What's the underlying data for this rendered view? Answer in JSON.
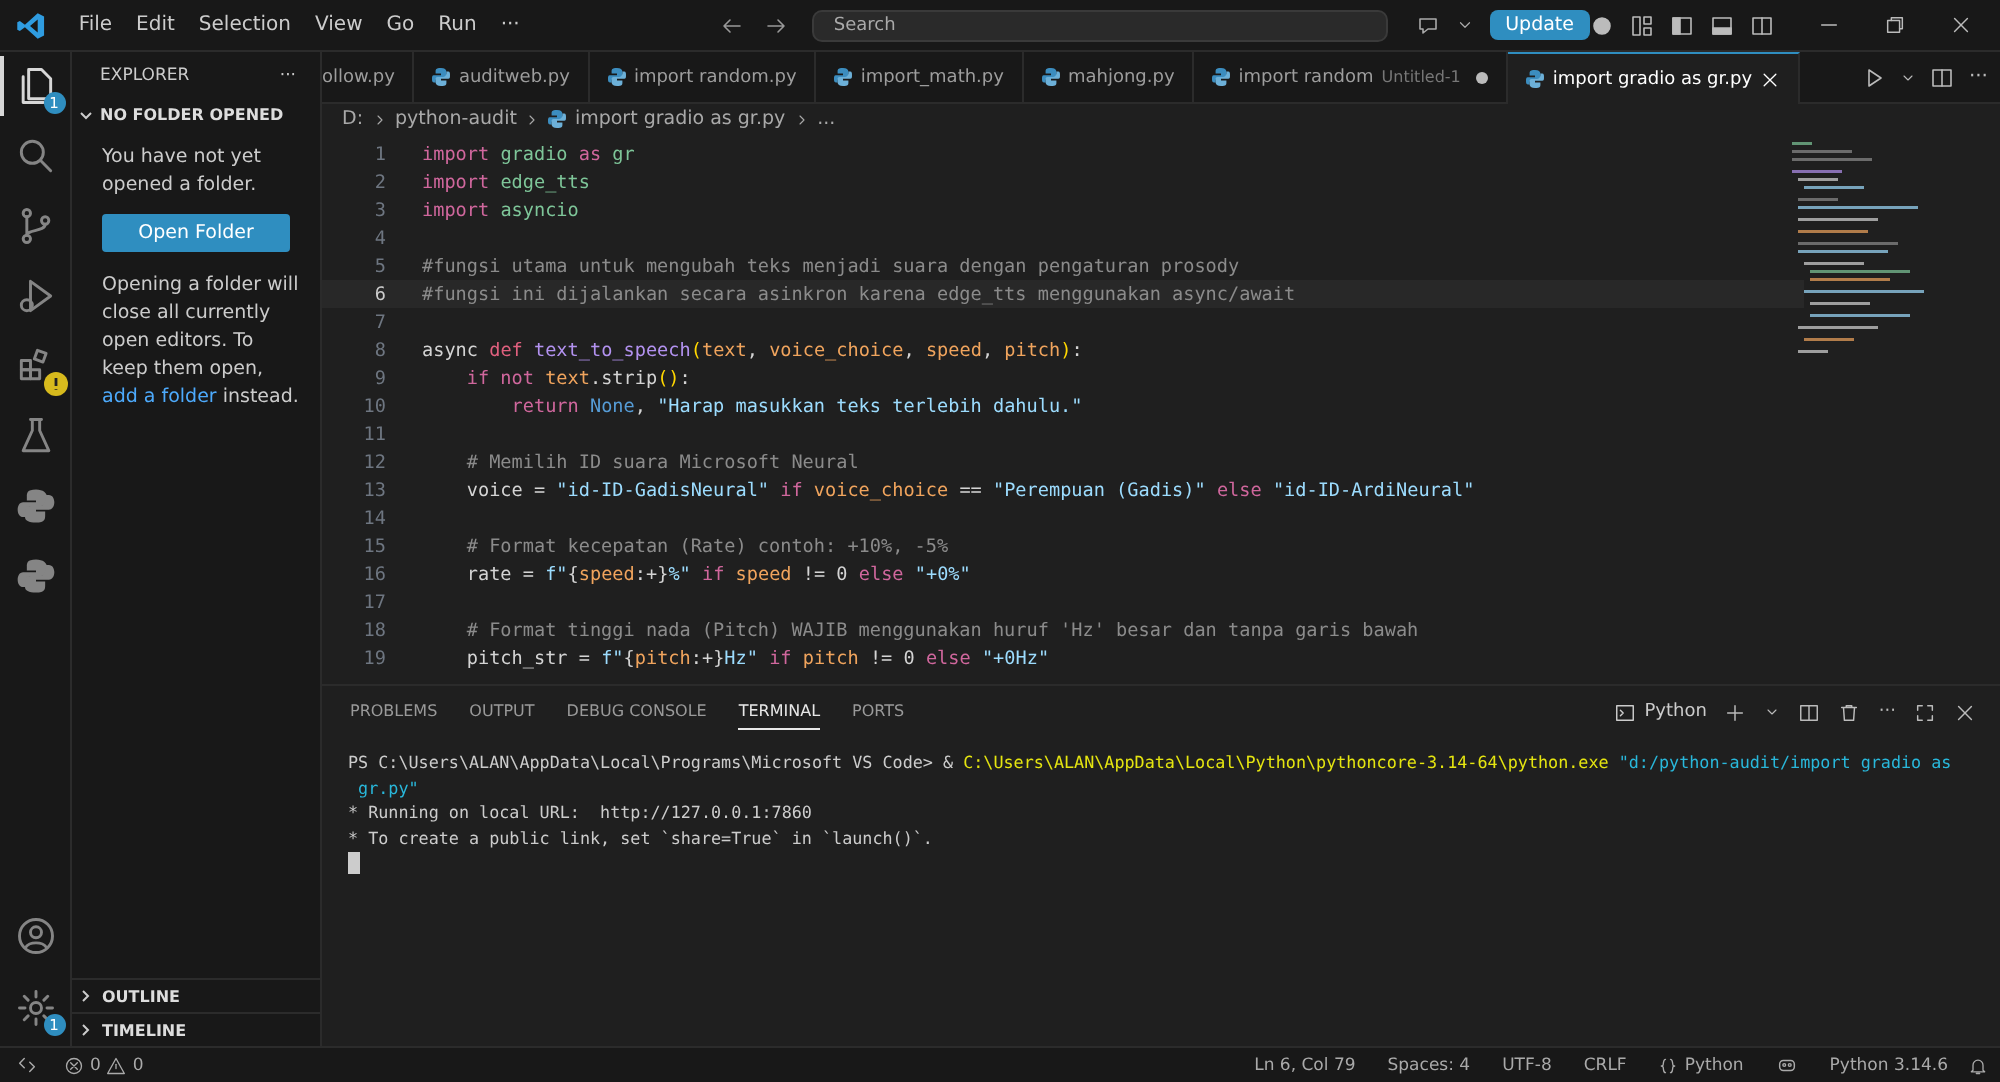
{
  "title_bar": {
    "menu": [
      "File",
      "Edit",
      "Selection",
      "View",
      "Go",
      "Run",
      "···"
    ],
    "search": {
      "placeholder": "Search"
    },
    "update_button": "Update"
  },
  "activity_bar": {
    "top": [
      {
        "kind": "files",
        "selected": true,
        "badge": "1"
      },
      {
        "kind": "search",
        "selected": false
      },
      {
        "kind": "source-control",
        "selected": false
      },
      {
        "kind": "run-debug",
        "selected": false
      },
      {
        "kind": "extensions",
        "selected": false,
        "warning": true
      },
      {
        "kind": "testing",
        "selected": false
      },
      {
        "kind": "python",
        "selected": false
      },
      {
        "kind": "python",
        "selected": false
      }
    ],
    "bottom": [
      {
        "kind": "account",
        "selected": false
      },
      {
        "kind": "settings",
        "selected": false,
        "badge": "1"
      }
    ]
  },
  "sidebar": {
    "title": "EXPLORER",
    "more": "···",
    "section": {
      "title": "NO FOLDER OPENED",
      "expanded": true
    },
    "message": "You have not yet opened a folder.",
    "open_folder_button": "Open Folder",
    "note": {
      "before": "Opening a folder will close all currently open editors. To keep them open, ",
      "link": "add a folder",
      "after": " instead."
    },
    "bottom_sections": [
      {
        "title": "OUTLINE",
        "expanded": false
      },
      {
        "title": "TIMELINE",
        "expanded": false
      }
    ]
  },
  "tabs": [
    {
      "label": "ollow.py",
      "selected": false
    },
    {
      "label": "auditweb.py",
      "selected": false
    },
    {
      "label": "import random.py",
      "selected": false
    },
    {
      "label": "import_math.py",
      "selected": false
    },
    {
      "label": "mahjong.py",
      "selected": false
    },
    {
      "label": "import random",
      "detail": "Untitled-1",
      "dirty": true,
      "selected": false
    },
    {
      "label": "import gradio as gr.py",
      "selected": true
    }
  ],
  "editor_actions_more": "···",
  "breadcrumb": [
    "D:",
    "python-audit",
    "import gradio as gr.py",
    "..."
  ],
  "code": [
    {
      "n": "1",
      "current": false,
      "tokens": [
        {
          "kind": "kw",
          "text": "import "
        },
        {
          "kind": "mod",
          "text": "gradio "
        },
        {
          "kind": "kw",
          "text": "as "
        },
        {
          "kind": "mod",
          "text": "gr"
        }
      ]
    },
    {
      "n": "2",
      "current": false,
      "tokens": [
        {
          "kind": "kw",
          "text": "import "
        },
        {
          "kind": "mod",
          "text": "edge_tts"
        }
      ]
    },
    {
      "n": "3",
      "current": false,
      "tokens": [
        {
          "kind": "kw",
          "text": "import "
        },
        {
          "kind": "mod",
          "text": "asyncio"
        }
      ]
    },
    {
      "n": "4",
      "current": false
    },
    {
      "n": "5",
      "current": false,
      "tokens": [
        {
          "kind": "cm",
          "text": "#fungsi utama untuk mengubah teks menjadi suara dengan pengaturan prosody"
        }
      ]
    },
    {
      "n": "6",
      "current": true,
      "tokens": [
        {
          "kind": "cm",
          "text": "#fungsi ini dijalankan secara asinkron karena edge_tts menggunakan async/await"
        }
      ]
    },
    {
      "n": "7",
      "current": false
    },
    {
      "n": "8",
      "current": false,
      "tokens": [
        {
          "kind": "p",
          "text": "async "
        },
        {
          "kind": "def",
          "text": "def "
        },
        {
          "kind": "fn",
          "text": "text_to_speech"
        },
        {
          "kind": "br",
          "text": "("
        },
        {
          "kind": "param",
          "text": "text"
        },
        {
          "kind": "p",
          "text": ", "
        },
        {
          "kind": "param",
          "text": "voice_choice"
        },
        {
          "kind": "p",
          "text": ", "
        },
        {
          "kind": "param",
          "text": "speed"
        },
        {
          "kind": "p",
          "text": ", "
        },
        {
          "kind": "param",
          "text": "pitch"
        },
        {
          "kind": "br",
          "text": ")"
        },
        {
          "kind": "p",
          "text": ":"
        }
      ]
    },
    {
      "n": "9",
      "current": false,
      "tokens": [
        {
          "kind": "kw",
          "text": "    if not "
        },
        {
          "kind": "param",
          "text": "text"
        },
        {
          "kind": "p",
          "text": ".strip"
        },
        {
          "kind": "br",
          "text": "()"
        },
        {
          "kind": "p",
          "text": ":"
        }
      ]
    },
    {
      "n": "10",
      "current": false,
      "tokens": [
        {
          "kind": "kw",
          "text": "        return "
        },
        {
          "kind": "const",
          "text": "None"
        },
        {
          "kind": "p",
          "text": ", "
        },
        {
          "kind": "str",
          "text": "\"Harap masukkan teks terlebih dahulu.\""
        }
      ]
    },
    {
      "n": "11",
      "current": false
    },
    {
      "n": "12",
      "current": false,
      "tokens": [
        {
          "kind": "cm",
          "text": "    # Memilih ID suara Microsoft Neural"
        }
      ]
    },
    {
      "n": "13",
      "current": false,
      "tokens": [
        {
          "kind": "p",
          "text": "    voice = "
        },
        {
          "kind": "str",
          "text": "\"id-ID-GadisNeural\" "
        },
        {
          "kind": "kw",
          "text": "if "
        },
        {
          "kind": "param",
          "text": "voice_choice"
        },
        {
          "kind": "p",
          "text": " == "
        },
        {
          "kind": "str",
          "text": "\"Perempuan (Gadis)\" "
        },
        {
          "kind": "kw",
          "text": "else "
        },
        {
          "kind": "str",
          "text": "\"id-ID-ArdiNeural\""
        }
      ]
    },
    {
      "n": "14",
      "current": false
    },
    {
      "n": "15",
      "current": false,
      "tokens": [
        {
          "kind": "cm",
          "text": "    # Format kecepatan (Rate) contoh: +10%, -5%"
        }
      ]
    },
    {
      "n": "16",
      "current": false,
      "tokens": [
        {
          "kind": "p",
          "text": "    rate = "
        },
        {
          "kind": "str",
          "text": "f\""
        },
        {
          "kind": "p",
          "text": "{"
        },
        {
          "kind": "param",
          "text": "speed"
        },
        {
          "kind": "p",
          "text": ":+}"
        },
        {
          "kind": "str",
          "text": "%\" "
        },
        {
          "kind": "kw",
          "text": "if "
        },
        {
          "kind": "param",
          "text": "speed"
        },
        {
          "kind": "p",
          "text": " != 0 "
        },
        {
          "kind": "kw",
          "text": "else "
        },
        {
          "kind": "str",
          "text": "\"+0%\""
        }
      ]
    },
    {
      "n": "17",
      "current": false
    },
    {
      "n": "18",
      "current": false,
      "tokens": [
        {
          "kind": "cm",
          "text": "    # Format tinggi nada (Pitch) WAJIB menggunakan huruf 'Hz' besar dan tanpa garis bawah"
        }
      ]
    },
    {
      "n": "19",
      "current": false,
      "tokens": [
        {
          "kind": "p",
          "text": "    pitch_str = "
        },
        {
          "kind": "str",
          "text": "f\""
        },
        {
          "kind": "p",
          "text": "{"
        },
        {
          "kind": "param",
          "text": "pitch"
        },
        {
          "kind": "p",
          "text": ":+}"
        },
        {
          "kind": "str",
          "text": "Hz\" "
        },
        {
          "kind": "kw",
          "text": "if "
        },
        {
          "kind": "param",
          "text": "pitch"
        },
        {
          "kind": "p",
          "text": " != 0 "
        },
        {
          "kind": "kw",
          "text": "else "
        },
        {
          "kind": "str",
          "text": "\"+0Hz\""
        }
      ]
    }
  ],
  "panel": {
    "tabs": [
      {
        "label": "PROBLEMS",
        "selected": false
      },
      {
        "label": "OUTPUT",
        "selected": false
      },
      {
        "label": "DEBUG CONSOLE",
        "selected": false
      },
      {
        "label": "TERMINAL",
        "selected": true
      },
      {
        "label": "PORTS",
        "selected": false
      }
    ],
    "terminal_profile": "Python",
    "more": "···",
    "terminal": [
      [
        {
          "kind": "p",
          "text": "PS C:\\Users\\ALAN\\AppData\\Local\\Programs\\Microsoft VS Code> & "
        },
        {
          "kind": "path",
          "text": "C:\\Users\\ALAN\\AppData\\Local\\Python\\pythoncore-3.14-64\\python.exe "
        },
        {
          "kind": "arg",
          "text": "\"d:/python-audit/import gradio as"
        }
      ],
      [
        {
          "kind": "arg",
          "text": " gr.py\""
        }
      ],
      [
        {
          "kind": "p",
          "text": "* Running on local URL:  http://127.0.0.1:7860"
        }
      ],
      [
        {
          "kind": "p",
          "text": "* To create a public link, set `share=True` in `launch()`."
        }
      ]
    ]
  },
  "status_bar": {
    "errors": "0",
    "warnings": "0",
    "position": "Ln 6, Col 79",
    "spaces": "Spaces: 4",
    "encoding": "UTF-8",
    "eol": "CRLF",
    "language": "Python",
    "interpreter": "Python 3.14.6"
  }
}
